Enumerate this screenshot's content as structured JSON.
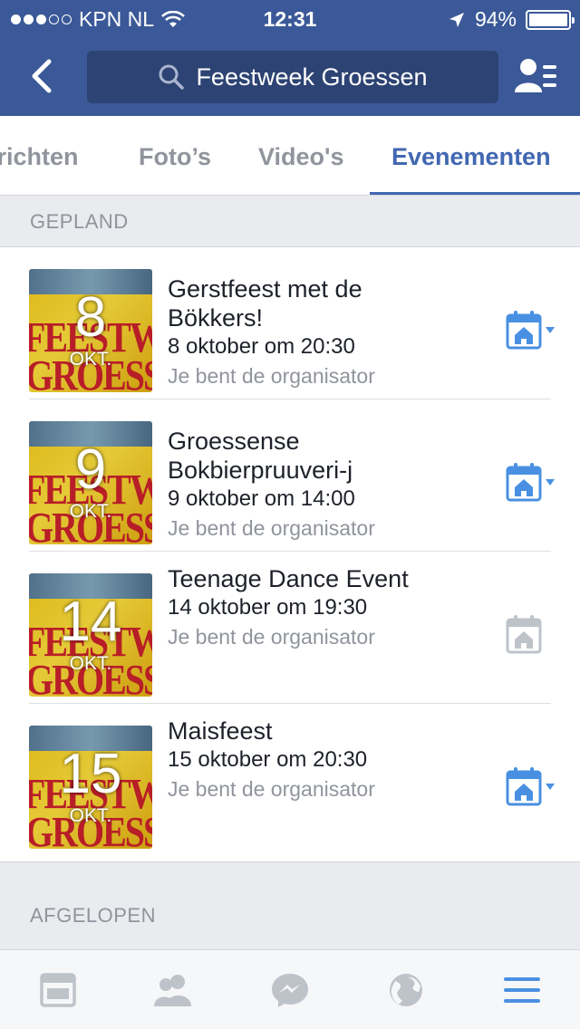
{
  "status": {
    "carrier": "KPN NL",
    "time": "12:31",
    "battery": "94%"
  },
  "header": {
    "search_text": "Feestweek Groessen"
  },
  "tabs": [
    {
      "label": "Berichten"
    },
    {
      "label": "Foto’s"
    },
    {
      "label": "Video's"
    },
    {
      "label": "Evenementen"
    }
  ],
  "sections": {
    "planned": "GEPLAND",
    "past": "AFGELOPEN"
  },
  "events": [
    {
      "day": "8",
      "month": "OKT.",
      "title_line1": "Gerstfeest met de",
      "title_line2": "Bökkers!",
      "when": "8 oktober om 20:30",
      "role": "Je bent de organisator",
      "calendar_active": true
    },
    {
      "day": "9",
      "month": "OKT.",
      "title_line1": "Groessense",
      "title_line2": "Bokbierpruuveri-j",
      "when": "9 oktober om 14:00",
      "role": "Je bent de organisator",
      "calendar_active": true
    },
    {
      "day": "14",
      "month": "OKT.",
      "title_line1": "Teenage Dance Event",
      "title_line2": "",
      "when": "14 oktober om 19:30",
      "role": "Je bent de organisator",
      "calendar_active": false
    },
    {
      "day": "15",
      "month": "OKT.",
      "title_line1": "Maisfeest",
      "title_line2": "",
      "when": "15 oktober om 20:30",
      "role": "Je bent de organisator",
      "calendar_active": true
    }
  ],
  "thumb_text": {
    "line1": "FEESTWEEK",
    "line2": "GROESSEN"
  },
  "colors": {
    "brand": "#3b5998",
    "accent": "#4267b2",
    "muted": "#90949c",
    "thumb_red": "#c2202a",
    "thumb_yellow": "#e8c21b"
  },
  "bottom_nav": [
    {
      "icon": "news-feed-icon"
    },
    {
      "icon": "friends-icon"
    },
    {
      "icon": "messenger-icon"
    },
    {
      "icon": "globe-icon"
    },
    {
      "icon": "menu-icon"
    }
  ]
}
